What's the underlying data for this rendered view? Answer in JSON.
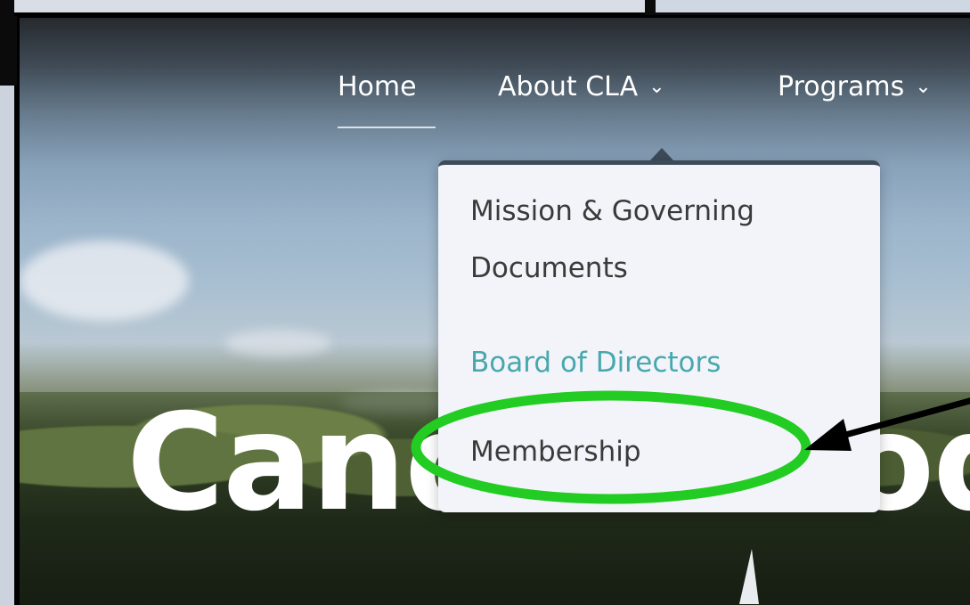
{
  "nav": {
    "home_label": "Home",
    "about_label": "About CLA",
    "programs_label": "Programs"
  },
  "dropdown": {
    "items": [
      {
        "label_line1": "Mission & Governing",
        "label_line2": "Documents"
      },
      {
        "label": "Board of Directors"
      },
      {
        "label": "Membership"
      }
    ]
  },
  "hero": {
    "title": "Candlewood La"
  },
  "colors": {
    "dropdown_background": "#f2f4f9",
    "dropdown_border": "#3d4a58",
    "active_link": "#47a8ae",
    "highlight_ellipse": "#22cc22",
    "arrow": "#000000"
  },
  "icons": {
    "chevron": "chevron-down-icon",
    "caret": "dropdown-caret-icon"
  }
}
